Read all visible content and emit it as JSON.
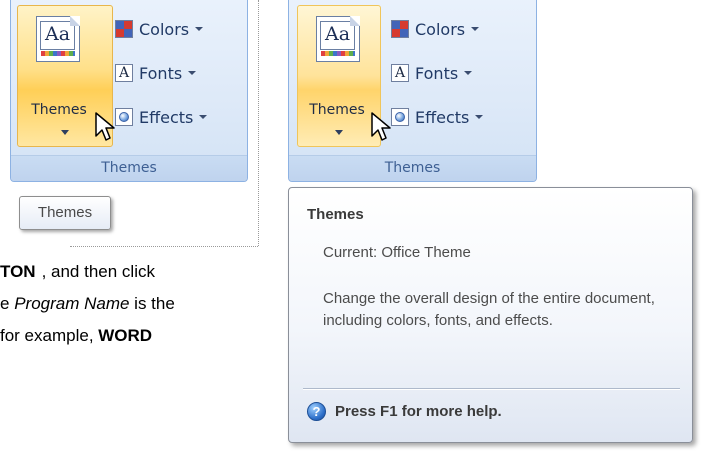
{
  "left_panel": {
    "themes_button_label": "Themes",
    "colors_label": "Colors",
    "fonts_label": "Fonts",
    "effects_label": "Effects",
    "group_caption": "Themes",
    "tooltip_label": "Themes"
  },
  "right_panel": {
    "themes_button_label": "Themes",
    "colors_label": "Colors",
    "fonts_label": "Fonts",
    "effects_label": "Effects",
    "group_caption": "Themes"
  },
  "document_text": {
    "line1_bold": "TON",
    "line1_rest": ", and then click",
    "line2_prefix": "e ",
    "line2_italic": "Program Name",
    "line2_rest": " is the",
    "line3_plain": " for example, ",
    "line3_bold": "WORD"
  },
  "supertip": {
    "title": "Themes",
    "current": "Current: Office Theme",
    "description": "Change the overall design of the entire document, including colors, fonts, and effects.",
    "help": "Press F1 for more help."
  },
  "icons": [
    "themes-icon",
    "colors-icon",
    "fonts-icon",
    "effects-icon",
    "cursor-icon",
    "help-icon"
  ]
}
